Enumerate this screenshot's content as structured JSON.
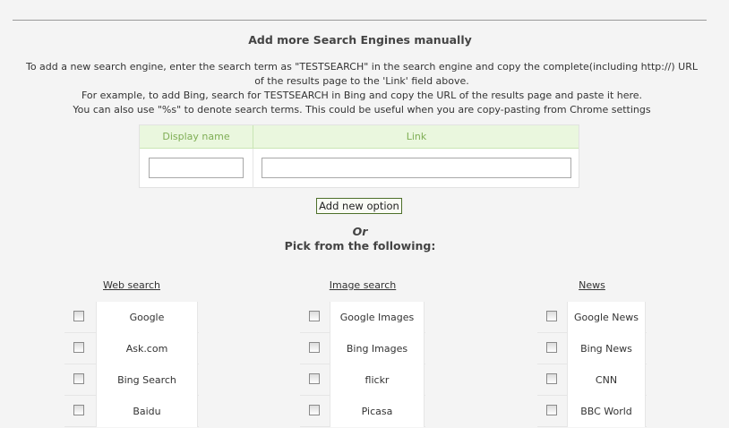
{
  "heading": "Add more Search Engines manually",
  "instructions": [
    "To add a new search engine, enter the search term as \"TESTSEARCH\" in the search engine and copy the complete(including http://) URL",
    "of the results page to the 'Link' field above.",
    "For example, to add Bing, search for TESTSEARCH in Bing and copy the URL of the results page and paste it here.",
    "You can also use \"%s\" to denote search terms. This could be useful when you are copy-pasting from Chrome settings"
  ],
  "manual_table": {
    "col_display_name": "Display name",
    "col_link": "Link",
    "display_name_value": "",
    "link_value": ""
  },
  "add_button_label": "Add new option",
  "or_label": "Or",
  "pick_label": "Pick from the following:",
  "columns": [
    {
      "title": "Web search",
      "items": [
        {
          "label": "Google",
          "checked": false
        },
        {
          "label": "Ask.com",
          "checked": false
        },
        {
          "label": "Bing Search",
          "checked": false
        },
        {
          "label": "Baidu",
          "checked": false
        }
      ]
    },
    {
      "title": "Image search",
      "items": [
        {
          "label": "Google Images",
          "checked": false
        },
        {
          "label": "Bing Images",
          "checked": false
        },
        {
          "label": "flickr",
          "checked": false
        },
        {
          "label": "Picasa",
          "checked": false
        }
      ]
    },
    {
      "title": "News",
      "items": [
        {
          "label": "Google News",
          "checked": false
        },
        {
          "label": "Bing News",
          "checked": false
        },
        {
          "label": "CNN",
          "checked": false
        },
        {
          "label": "BBC World",
          "checked": false
        }
      ]
    }
  ]
}
